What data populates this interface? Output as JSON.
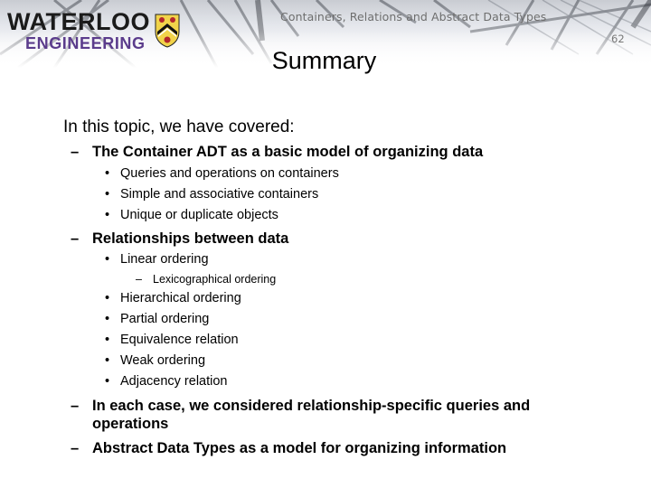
{
  "header": {
    "logo_line1": "WATERLOO",
    "logo_line2": "ENGINEERING",
    "course_title": "Containers, Relations and Abstract Data Types",
    "page_number": "62",
    "brand_purple": "#5b3c8c"
  },
  "slide": {
    "title": "Summary",
    "intro": "In this topic, we have covered:",
    "sections": [
      {
        "text": "The Container ADT as a basic model of organizing data",
        "items": [
          {
            "text": "Queries and operations on containers"
          },
          {
            "text": "Simple and associative containers"
          },
          {
            "text": "Unique or duplicate objects"
          }
        ]
      },
      {
        "text": "Relationships between data",
        "items": [
          {
            "text": "Linear ordering",
            "sub": [
              "Lexicographical ordering"
            ]
          },
          {
            "text": "Hierarchical ordering"
          },
          {
            "text": "Partial ordering"
          },
          {
            "text": "Equivalence relation"
          },
          {
            "text": "Weak ordering"
          },
          {
            "text": "Adjacency relation"
          }
        ]
      },
      {
        "text_line1": "In each case, we considered relationship-specific queries and",
        "text_line2": "operations"
      },
      {
        "text": "Abstract Data Types as a model for organizing information"
      }
    ],
    "dash_glyph": "–",
    "bullet_glyph": "•"
  }
}
